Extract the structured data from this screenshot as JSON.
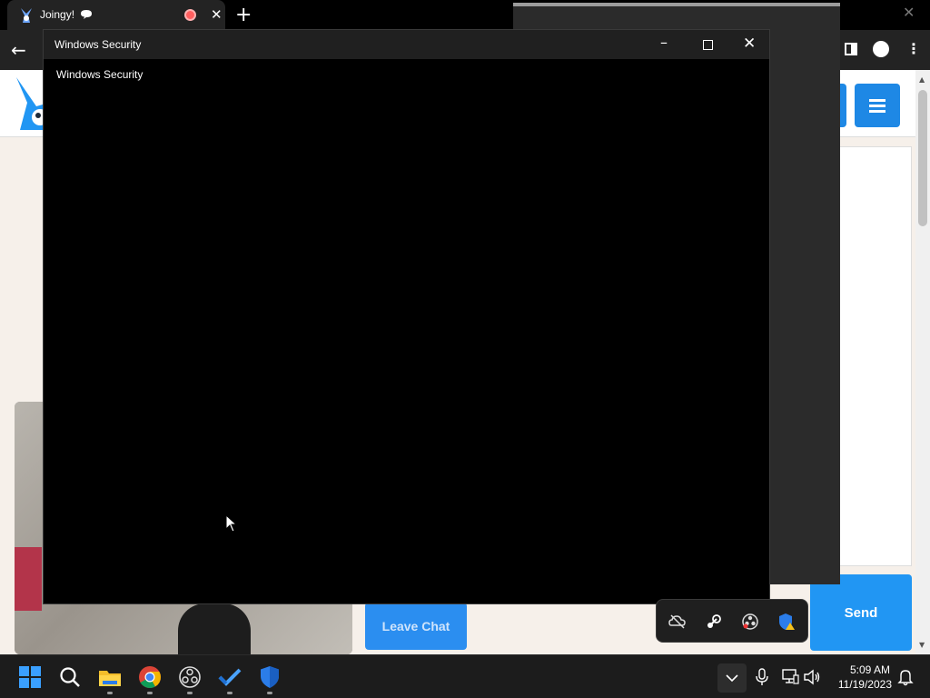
{
  "browser": {
    "tab_title": "Joingy!",
    "tab_close": "✕",
    "new_tab": "+",
    "back": "←",
    "menu": "⋮"
  },
  "page": {
    "leave_chat_label": "Leave Chat",
    "send_label": "Send"
  },
  "security_window": {
    "title": "Windows Security",
    "heading": "Windows Security",
    "minimize": "–",
    "close": "✕"
  },
  "taskbar": {
    "time": "5:09 AM",
    "date": "11/19/2023",
    "icons": [
      "start-icon",
      "search-icon",
      "file-explorer-icon",
      "chrome-icon",
      "obs-icon",
      "todo-icon",
      "windows-security-icon"
    ],
    "tray_icons": [
      "onedrive-off-icon",
      "steam-icon",
      "obs-tray-icon",
      "security-warning-icon",
      "microphone-icon",
      "network-icon",
      "volume-icon",
      "notification-bell-icon"
    ]
  },
  "colors": {
    "accent_blue": "#2196f3",
    "taskbar_bg": "#1c1c1c",
    "window_black": "#000000"
  }
}
